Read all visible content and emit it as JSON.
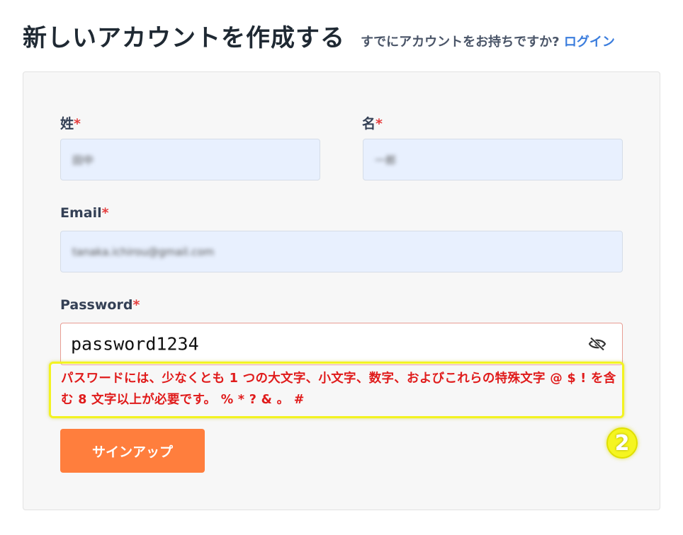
{
  "header": {
    "title": "新しいアカウントを作成する",
    "signin_prompt": "すでにアカウントをお持ちですか?",
    "signin_link": "ログイン"
  },
  "form": {
    "last_name": {
      "label": "姓",
      "required_mark": "*",
      "value": "田中"
    },
    "first_name": {
      "label": "名",
      "required_mark": "*",
      "value": "一郎"
    },
    "email": {
      "label": "Email",
      "required_mark": "*",
      "value": "tanaka.ichirou@gmail.com"
    },
    "password": {
      "label": "Password",
      "required_mark": "*",
      "value": "password1234",
      "toggle_icon": "eye-slash-icon"
    },
    "error_message": "パスワードには、少なくとも 1 つの大文字、小文字、数字、およびこれらの特殊文字 @ $ ! を含む 8 文字以上が必要です。 % * ? & 。 #",
    "submit_label": "サインアップ"
  },
  "annotation": {
    "marker": "2"
  },
  "colors": {
    "accent_button": "#ff7e3d",
    "link": "#3b7ddd",
    "error": "#e01b1b",
    "highlight": "#f3f321",
    "autofill_bg": "#e8f0fe"
  }
}
